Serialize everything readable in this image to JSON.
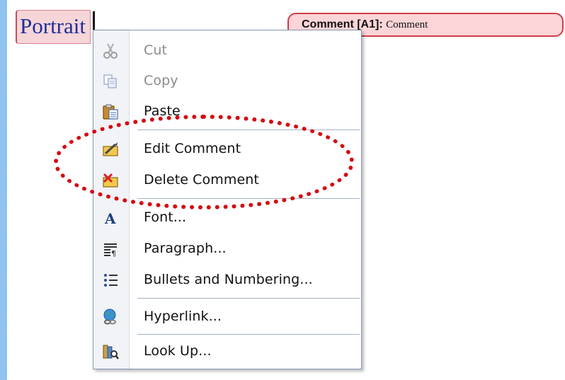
{
  "document": {
    "selected_word": "Portrait"
  },
  "comment": {
    "label": "Comment [A1]:",
    "text": "Comment"
  },
  "context_menu": {
    "items": [
      {
        "label": "Cut",
        "icon": "scissors-icon",
        "enabled": false
      },
      {
        "label": "Copy",
        "icon": "copy-icon",
        "enabled": false
      },
      {
        "label": "Paste",
        "icon": "paste-icon",
        "enabled": true
      },
      {
        "label": "Edit Comment",
        "icon": "edit-comment-icon",
        "enabled": true
      },
      {
        "label": "Delete Comment",
        "icon": "delete-comment-icon",
        "enabled": true
      },
      {
        "label": "Font...",
        "icon": "font-icon",
        "enabled": true
      },
      {
        "label": "Paragraph...",
        "icon": "paragraph-icon",
        "enabled": true
      },
      {
        "label": "Bullets and Numbering...",
        "icon": "bullets-icon",
        "enabled": true
      },
      {
        "label": "Hyperlink...",
        "icon": "hyperlink-icon",
        "enabled": true
      },
      {
        "label": "Look Up...",
        "icon": "lookup-icon",
        "enabled": true
      }
    ]
  },
  "colors": {
    "highlight_ellipse": "#d50a10",
    "comment_border": "#d23d48",
    "comment_fill": "#fbd5d8",
    "word_color": "#1f2f98",
    "menu_border": "#8597b6"
  }
}
